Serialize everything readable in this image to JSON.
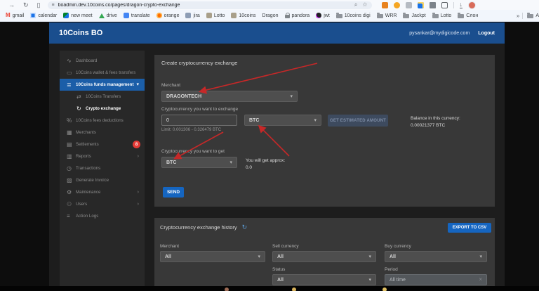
{
  "colors": {
    "header_blue": "#1a4e8e",
    "selected_blue": "#1b5ea8",
    "accent_blue": "#1565c0",
    "badge_red": "#e53935",
    "arrow_red": "#c62828",
    "card_bg": "#383838",
    "sidebar_bg": "#282828"
  },
  "icons": {
    "forward": "→",
    "reload": "↻",
    "reading_list": "▯",
    "tune": "≡",
    "zoom": "⌕",
    "star": "☆",
    "download": "↓",
    "overflow": "»",
    "chevron_down": "▾",
    "chevron_right": "›",
    "refresh": "↻",
    "clear": "×"
  },
  "browser": {
    "url": "boadmin.dev.10coins.co/pages/dragon-crypto-exchange",
    "bookmarks": [
      {
        "label": "gmail"
      },
      {
        "label": "calendar"
      },
      {
        "label": "new meet"
      },
      {
        "label": "drive"
      },
      {
        "label": "translate"
      },
      {
        "label": "orange"
      },
      {
        "label": "jira"
      },
      {
        "label": "Lotto"
      },
      {
        "label": "10coins"
      },
      {
        "label": "Dragon"
      },
      {
        "label": "pandora"
      },
      {
        "label": "jwt"
      },
      {
        "label": "10coins digi"
      },
      {
        "label": "WRR"
      },
      {
        "label": "Jackpt"
      },
      {
        "label": "Lotto"
      },
      {
        "label": "Слон"
      },
      {
        "label": "A"
      }
    ],
    "gmail_glyph": "M"
  },
  "header": {
    "title": "10Coins BO",
    "user_email": "pysankar@mydigicode.com",
    "logout_label": "Logout"
  },
  "sidebar": {
    "items": [
      {
        "label": "Dashboard",
        "icon": "∿"
      },
      {
        "label": "10Coins wallet & fees transfers",
        "icon": "▭"
      },
      {
        "label": "10Coins funds management",
        "icon": "≣"
      },
      {
        "label": "10Coins Transfers",
        "icon": "⇄"
      },
      {
        "label": "Crypto exchange",
        "icon": "↻"
      },
      {
        "label": "10Coins fees deductions",
        "icon": "%"
      },
      {
        "label": "Merchants",
        "icon": "▦"
      },
      {
        "label": "Settlements",
        "icon": "▤",
        "badge": "8"
      },
      {
        "label": "Reports",
        "icon": "▥"
      },
      {
        "label": "Transactions",
        "icon": "◷"
      },
      {
        "label": "Generate Invoice",
        "icon": "▧"
      },
      {
        "label": "Maintenance",
        "icon": "⚙"
      },
      {
        "label": "Users",
        "icon": "⚇"
      },
      {
        "label": "Action Logs",
        "icon": "≡"
      }
    ]
  },
  "create_exchange": {
    "title": "Create cryptocurrency exchange",
    "merchant_label": "Merchant",
    "merchant_value": "DRAGONTECH",
    "exchange_label": "Cryptocurrency you want to exchange",
    "amount_value": "0",
    "limit_text": "Limit: 0.001306 - 0.326479 BTC",
    "sell_currency_value": "BTC",
    "get_estimated_label": "GET ESTIMATED AMOUNT",
    "balance_label": "Balance in this currency:",
    "balance_value": "0.00021377 BTC",
    "get_label": "Cryptocurrency you want to get",
    "buy_currency_value": "BTC",
    "approx_label": "You will get approx:",
    "approx_value": "0.0",
    "send_label": "SEND"
  },
  "history": {
    "title": "Cryptocurrency exchange history",
    "export_label": "EXPORT TO CSV",
    "filters": {
      "merchant_label": "Merchant",
      "merchant_value": "All",
      "sell_label": "Sell currency",
      "sell_value": "All",
      "buy_label": "Buy currency",
      "buy_value": "All",
      "status_label": "Status",
      "status_value": "All",
      "period_label": "Period",
      "period_value": "All time"
    }
  }
}
